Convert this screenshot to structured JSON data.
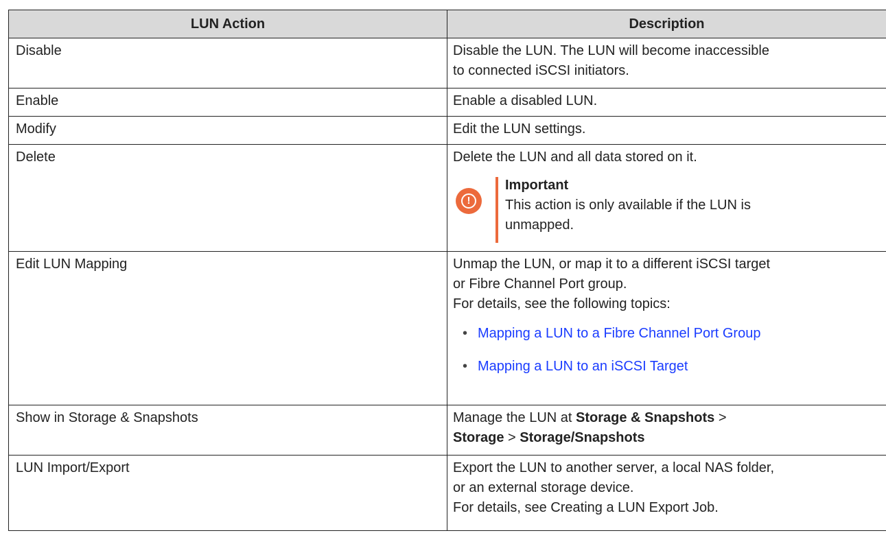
{
  "table": {
    "headers": {
      "action": "LUN Action",
      "description": "Description"
    },
    "rows": [
      {
        "action": "Disable",
        "desc": [
          "Disable the LUN. The LUN will become inaccessible",
          "to connected iSCSI initiators."
        ]
      },
      {
        "action": "Enable",
        "desc": [
          "Enable a disabled LUN."
        ]
      },
      {
        "action": "Modify",
        "desc": [
          "Edit the LUN settings."
        ]
      },
      {
        "action": "Delete",
        "desc": [
          "Delete the LUN and all data stored on it."
        ],
        "note": {
          "title": "Important",
          "lines": [
            "This action is only available if the LUN is",
            "unmapped."
          ]
        }
      },
      {
        "action": "Edit LUN Mapping",
        "desc": [
          "Unmap the LUN, or map it to a different iSCSI target",
          "or Fibre Channel Port group.",
          "For details, see the following topics:"
        ],
        "links": [
          "Mapping a LUN to a Fibre Channel Port Group",
          "Mapping a LUN to an iSCSI Target"
        ],
        "bullet": "•"
      },
      {
        "action": "Show in Storage & Snapshots",
        "desc_parts": {
          "p1": "Manage the LUN at ",
          "b1": "Storage & Snapshots",
          "p2": " >",
          "b2": "Storage",
          "p3": " > ",
          "b3": "Storage/Snapshots"
        }
      },
      {
        "action": "LUN Import/Export",
        "desc": [
          "Export the LUN to another server, a local NAS folder,",
          "or an external storage device.",
          "For details, see Creating a LUN Export Job."
        ]
      }
    ]
  },
  "colors": {
    "header_bg": "#d9d9d9",
    "important_accent": "#ec6a3c",
    "link": "#1a3cff"
  },
  "icons": {
    "important": "exclamation-circle-icon"
  }
}
